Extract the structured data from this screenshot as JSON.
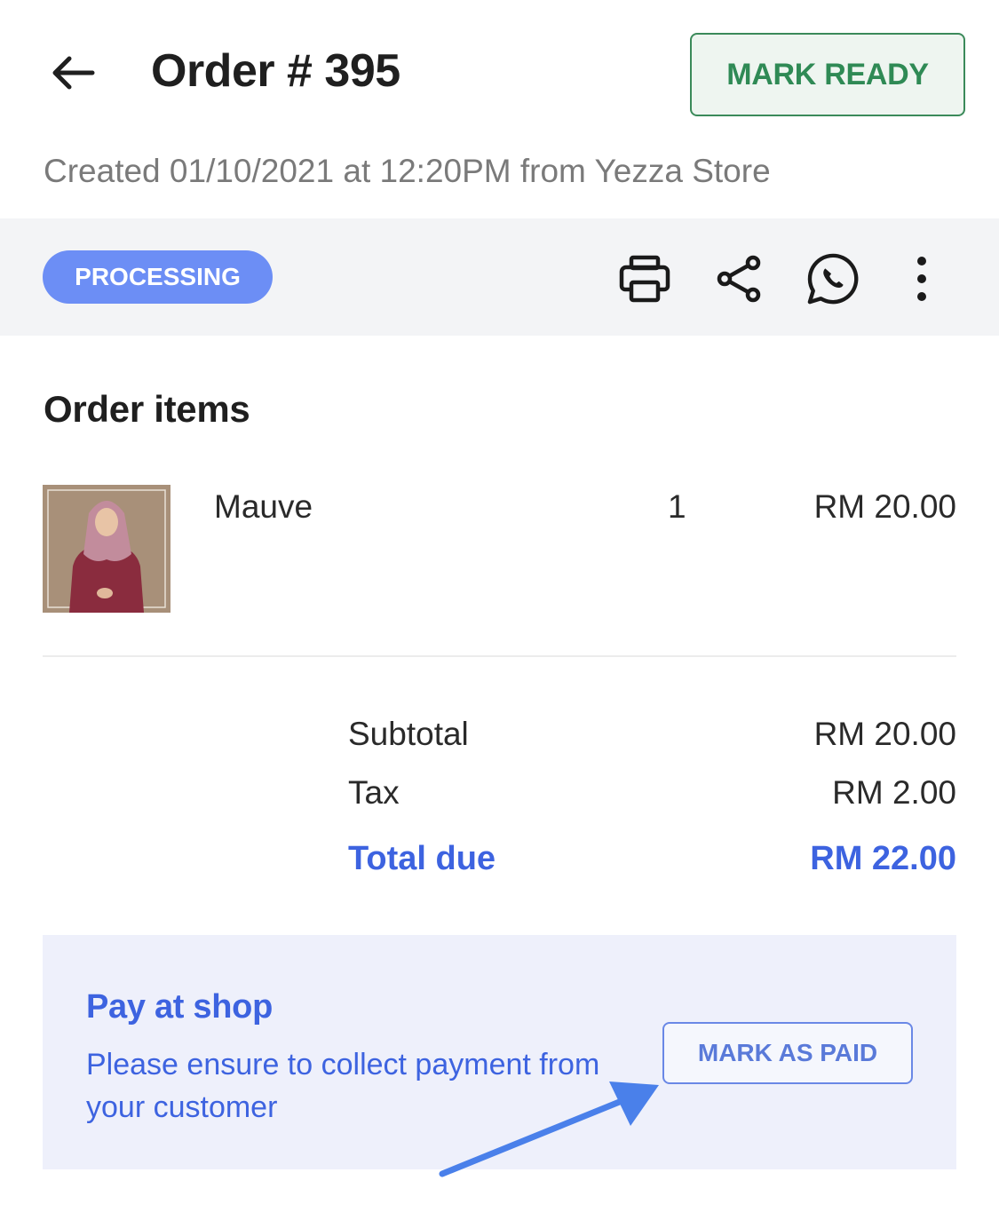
{
  "header": {
    "title": "Order # 395",
    "mark_ready_label": "MARK READY",
    "created_line": "Created 01/10/2021 at 12:20PM from Yezza Store"
  },
  "status_bar": {
    "status": "PROCESSING",
    "status_color": "#6c8ef5",
    "actions": [
      "printer-icon",
      "share-icon",
      "whatsapp-icon",
      "more-vertical-icon"
    ]
  },
  "order_items": {
    "title": "Order items",
    "items": [
      {
        "name": "Mauve",
        "quantity": "1",
        "price": "RM 20.00"
      }
    ]
  },
  "totals": {
    "subtotal_label": "Subtotal",
    "subtotal_value": "RM 20.00",
    "tax_label": "Tax",
    "tax_value": "RM 2.00",
    "total_label": "Total due",
    "total_value": "RM 22.00"
  },
  "payment": {
    "title": "Pay at shop",
    "description": "Please ensure to collect payment from your customer",
    "mark_paid_label": "MARK AS PAID"
  },
  "colors": {
    "accent_blue": "#3d63e0",
    "ready_green": "#2f8a55"
  }
}
